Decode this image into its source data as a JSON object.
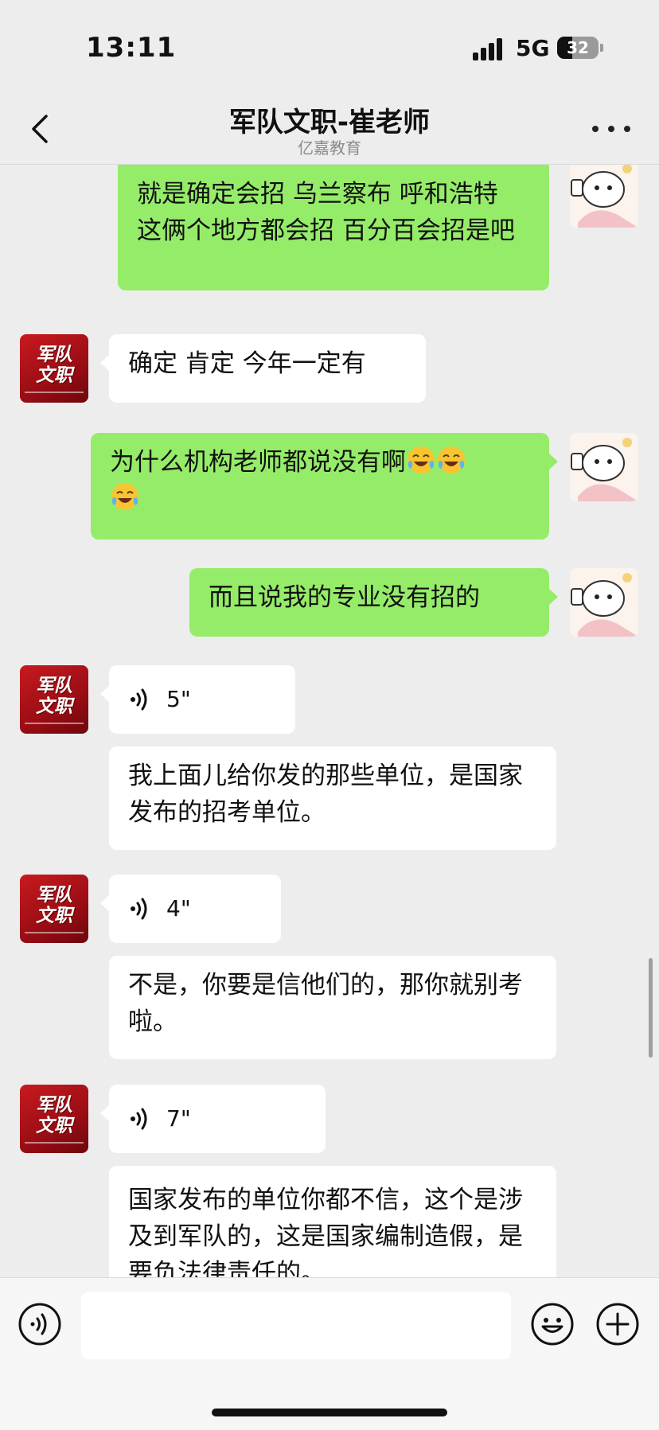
{
  "status_bar": {
    "time": "13:11",
    "network": "5G",
    "battery": "32"
  },
  "header": {
    "title": "军队文职-崔老师",
    "subtitle": "亿嘉教育"
  },
  "avatars": {
    "teacher_line1": "军队",
    "teacher_line2": "文职"
  },
  "messages": [
    {
      "from": "me",
      "text": "就是确定会招 乌兰察布 呼和浩特 这俩个地方都会招 百分百会招是吧"
    },
    {
      "from": "them",
      "text": "确定 肯定 今年一定有"
    },
    {
      "from": "me",
      "text": "为什么机构老师都说没有啊",
      "emojis": [
        "crying-laughing-emoji",
        "crying-laughing-emoji",
        "crying-laughing-emoji"
      ]
    },
    {
      "from": "me",
      "text": "而且说我的专业没有招的"
    },
    {
      "from": "them",
      "type": "voice",
      "duration": "5\""
    },
    {
      "from": "them",
      "text": "我上面儿给你发的那些单位，是国家发布的招考单位。"
    },
    {
      "from": "them",
      "type": "voice",
      "duration": "4\""
    },
    {
      "from": "them",
      "text": "不是，你要是信他们的，那你就别考啦。"
    },
    {
      "from": "them",
      "type": "voice",
      "duration": "7\""
    },
    {
      "from": "them",
      "text": "国家发布的单位你都不信，这个是涉及到军队的，这是国家编制造假，是要负法律责任的。"
    }
  ],
  "colors": {
    "my_bubble": "#95ec69",
    "their_bubble": "#ffffff",
    "background": "#ededed"
  }
}
